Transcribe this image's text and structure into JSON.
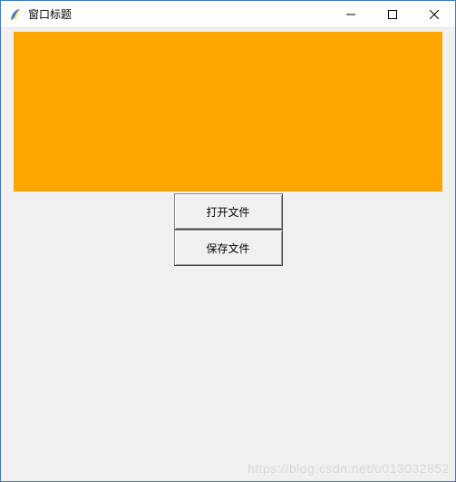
{
  "window": {
    "title": "窗口标题"
  },
  "canvas": {
    "color": "#ffa500"
  },
  "buttons": {
    "open_label": "打开文件",
    "save_label": "保存文件"
  },
  "watermark": "https://blog.csdn.net/u013032852"
}
